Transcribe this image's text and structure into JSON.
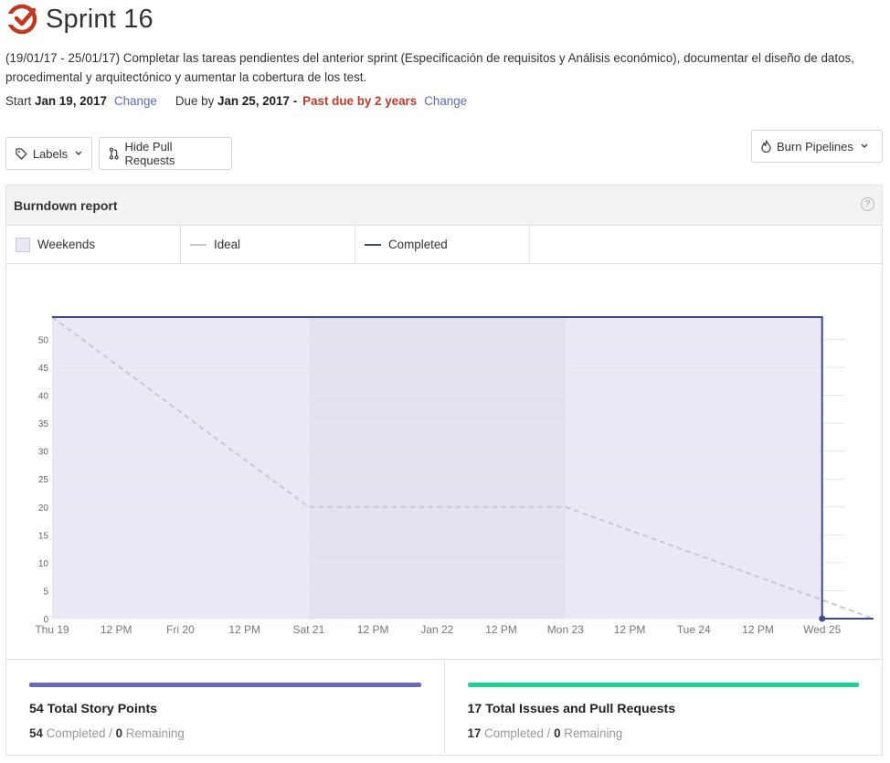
{
  "header": {
    "title": "Sprint 16",
    "description": "(19/01/17 - 25/01/17) Completar las tareas pendientes del anterior sprint (Especificación de requisitos y Análisis económico), documentar el diseño de datos, procedimental y arquitectónico y aumentar la cobertura de los test.",
    "start_label": "Start",
    "start_date": "Jan 19, 2017",
    "start_change": "Change",
    "due_label": "Due by",
    "due_date": "Jan 25, 2017",
    "due_sep": "-",
    "past_due": "Past due by 2 years",
    "due_change": "Change"
  },
  "controls": {
    "labels_button": "Labels",
    "hide_pr_button": "Hide Pull Requests",
    "burn_pipelines_button": "Burn Pipelines"
  },
  "report": {
    "title": "Burndown report",
    "help": "?",
    "legend": [
      {
        "label": "Weekends"
      },
      {
        "label": "Ideal"
      },
      {
        "label": "Completed"
      }
    ]
  },
  "colors": {
    "accent": "#5c6bc0",
    "completed_line": "#3f4a8a",
    "ideal_line": "#c8c8d4",
    "weekend_fill": "#e8e8f5",
    "past_due": "#c0392b",
    "issues_bar": "#1ed197",
    "points_bar": "#6b68b8"
  },
  "chart_data": {
    "type": "area",
    "x_ticks": [
      "Thu 19",
      "12 PM",
      "Fri 20",
      "12 PM",
      "Sat 21",
      "12 PM",
      "Jan 22",
      "12 PM",
      "Mon 23",
      "12 PM",
      "Tue 24",
      "12 PM",
      "Wed 25"
    ],
    "y_ticks": [
      0,
      5,
      10,
      15,
      20,
      25,
      30,
      35,
      40,
      45,
      50
    ],
    "ylim": [
      0,
      54
    ],
    "weekend_range_days": [
      2,
      4
    ],
    "series": [
      {
        "name": "Ideal",
        "style": "dashed",
        "points": [
          [
            0,
            54
          ],
          [
            2,
            20
          ],
          [
            4,
            20
          ],
          [
            6.4,
            0
          ]
        ]
      },
      {
        "name": "Completed",
        "style": "step",
        "points": [
          [
            0,
            54
          ],
          [
            6,
            54
          ],
          [
            6,
            0
          ],
          [
            6.4,
            0
          ]
        ]
      }
    ]
  },
  "stats": [
    {
      "title": "54 Total Story Points",
      "completed": "54",
      "completed_label": "Completed",
      "sep": "/",
      "remaining": "0",
      "remaining_label": "Remaining"
    },
    {
      "title": "17 Total Issues and Pull Requests",
      "completed": "17",
      "completed_label": "Completed",
      "sep": "/",
      "remaining": "0",
      "remaining_label": "Remaining"
    }
  ]
}
